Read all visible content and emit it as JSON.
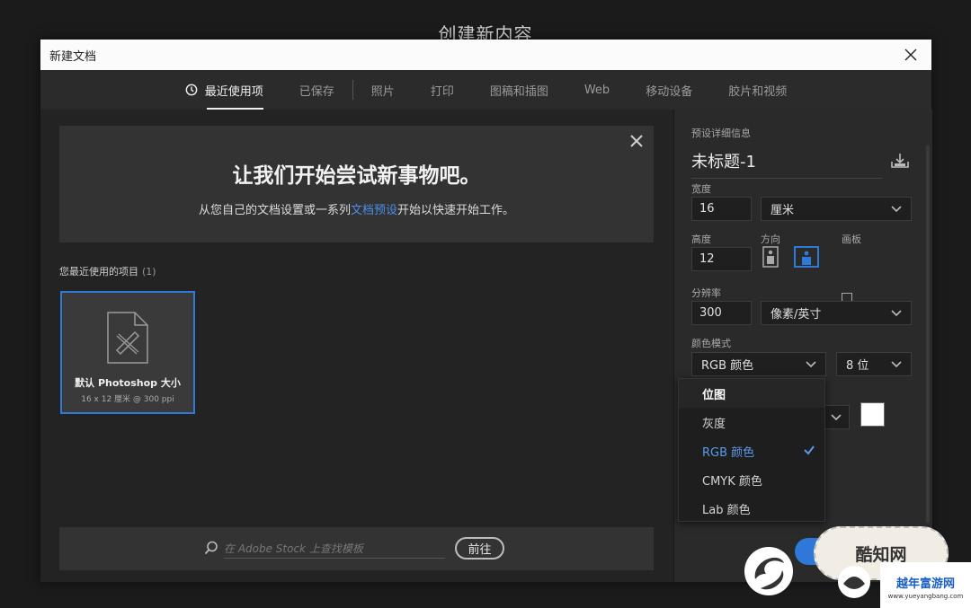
{
  "background_title": "创建新内容",
  "window": {
    "title": "新建文档"
  },
  "tabs": [
    {
      "label": "最近使用项",
      "icon": "clock-icon",
      "active": true
    },
    {
      "label": "已保存"
    },
    {
      "label": "照片"
    },
    {
      "label": "打印"
    },
    {
      "label": "图稿和插图"
    },
    {
      "label": "Web"
    },
    {
      "label": "移动设备"
    },
    {
      "label": "胶片和视频"
    }
  ],
  "banner": {
    "headline": "让我们开始尝试新事物吧。",
    "text_before": "从您自己的文档设置或一系列",
    "link": "文档预设",
    "text_after": "开始以快速开始工作。"
  },
  "recent": {
    "label": "您最近使用的项目",
    "count": "(1)",
    "items": [
      {
        "name": "默认 Photoshop 大小",
        "dims": "16 x 12 厘米 @ 300 ppi"
      }
    ]
  },
  "stock": {
    "placeholder": "在 Adobe Stock 上查找模板",
    "button": "前往"
  },
  "preset": {
    "section_label": "预设详细信息",
    "name": "未标题-1",
    "width_label": "宽度",
    "width_value": "16",
    "width_unit": "厘米",
    "height_label": "高度",
    "height_value": "12",
    "orientation_label": "方向",
    "artboard_label": "画板",
    "resolution_label": "分辨率",
    "resolution_value": "300",
    "resolution_unit": "像素/英寸",
    "color_mode_label": "颜色模式",
    "color_mode_value": "RGB 颜色",
    "bit_depth": "8 位"
  },
  "color_mode_menu": [
    {
      "label": "位图",
      "hover": true
    },
    {
      "label": "灰度"
    },
    {
      "label": "RGB 颜色",
      "selected": true
    },
    {
      "label": "CMYK 颜色"
    },
    {
      "label": "Lab 颜色"
    }
  ],
  "watermarks": {
    "badge": "酷知网",
    "site_name": "越年富游网",
    "site_url": "www.yueyangbang.com"
  },
  "colors": {
    "accent": "#2e7ad6",
    "link": "#4a8fe8",
    "dialog_bg": "#232323",
    "panel_bg": "#2a2a2a"
  }
}
